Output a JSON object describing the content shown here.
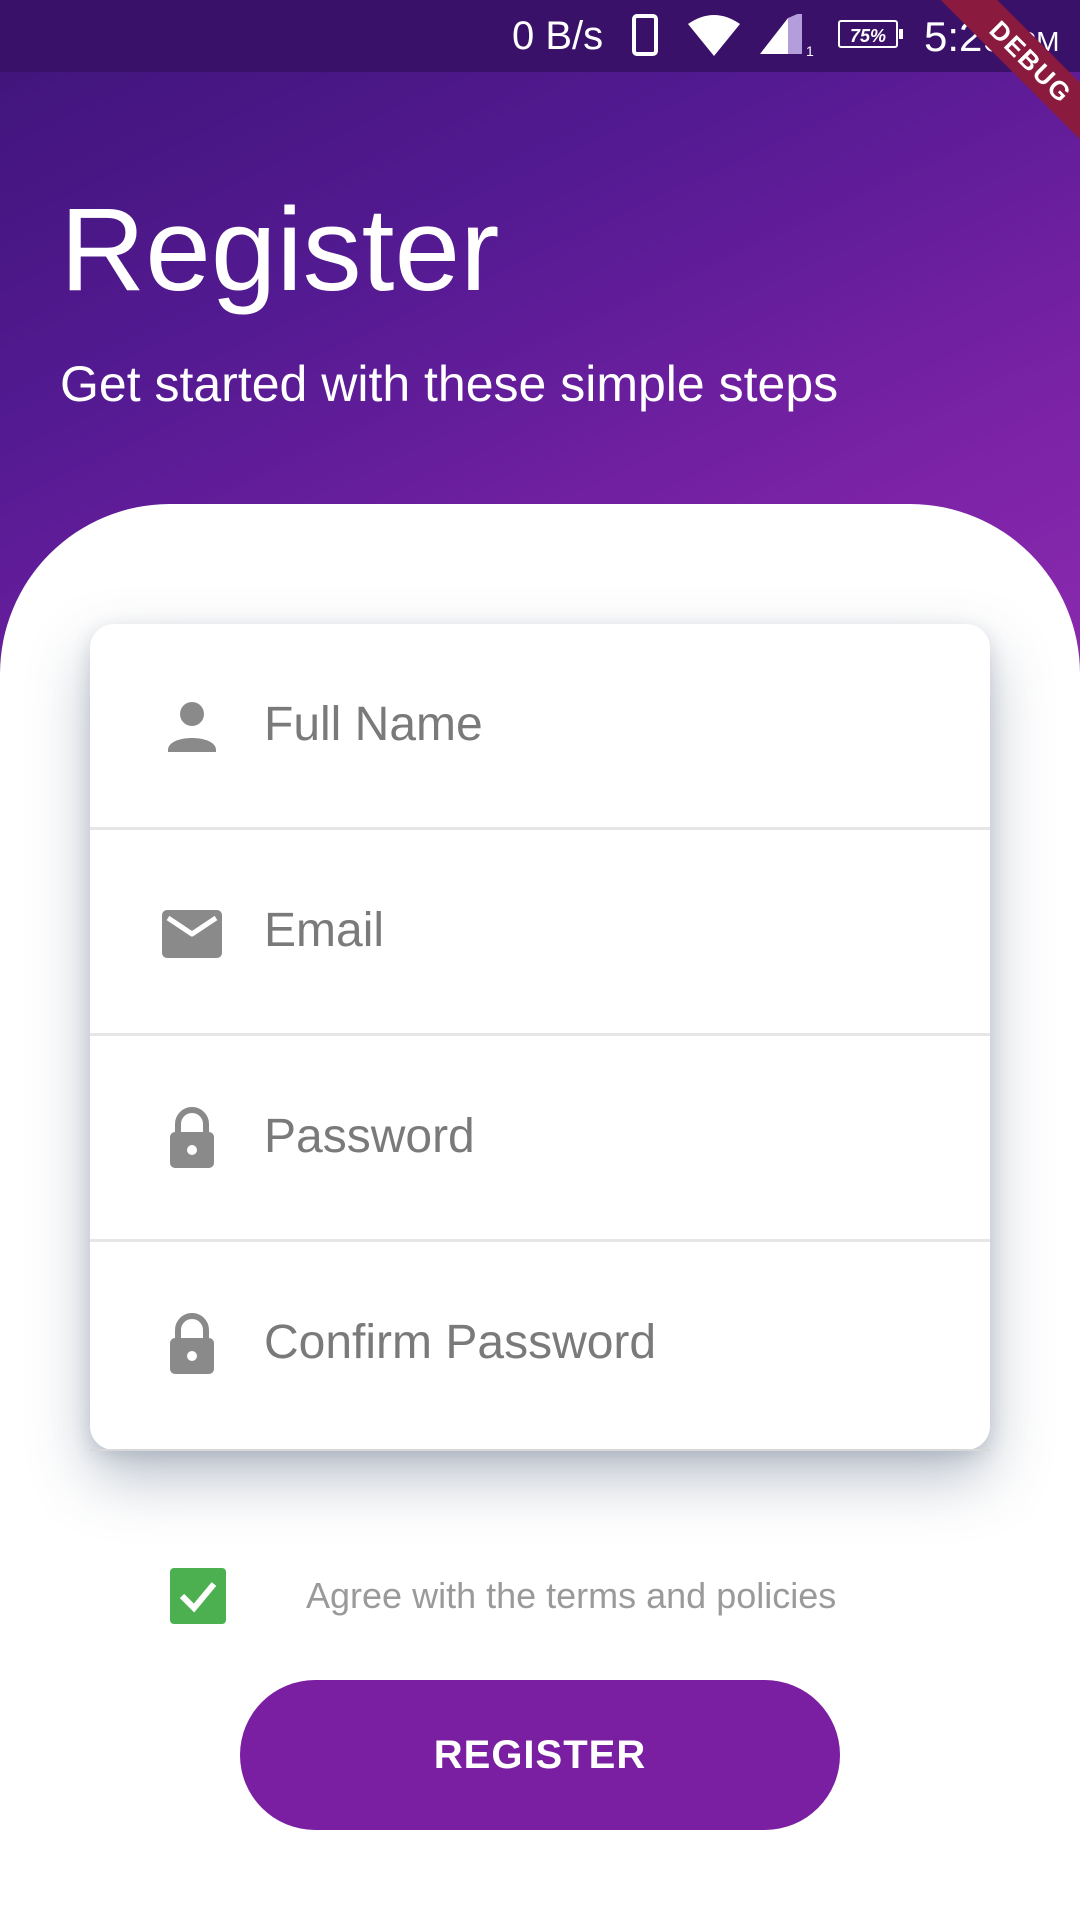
{
  "status_bar": {
    "network_speed": "0 B/s",
    "battery": "75%",
    "time": "5:29",
    "ampm": "PM",
    "sim_indicator": "1"
  },
  "debug_banner": "DEBUG",
  "header": {
    "title": "Register",
    "subtitle": "Get started with these simple steps"
  },
  "form": {
    "fields": [
      {
        "icon": "person-icon",
        "placeholder": "Full Name",
        "value": ""
      },
      {
        "icon": "email-icon",
        "placeholder": "Email",
        "value": ""
      },
      {
        "icon": "lock-icon",
        "placeholder": "Password",
        "value": ""
      },
      {
        "icon": "lock-icon",
        "placeholder": "Confirm Password",
        "value": ""
      }
    ]
  },
  "terms": {
    "label": "Agree with the terms and policies",
    "checked": true
  },
  "register_button": "REGISTER",
  "colors": {
    "header_gradient_start": "#3e1478",
    "header_gradient_end": "#8e2cb0",
    "button": "#7b1fa2",
    "checkbox": "#4caf50",
    "icon": "#8a8a8a"
  }
}
